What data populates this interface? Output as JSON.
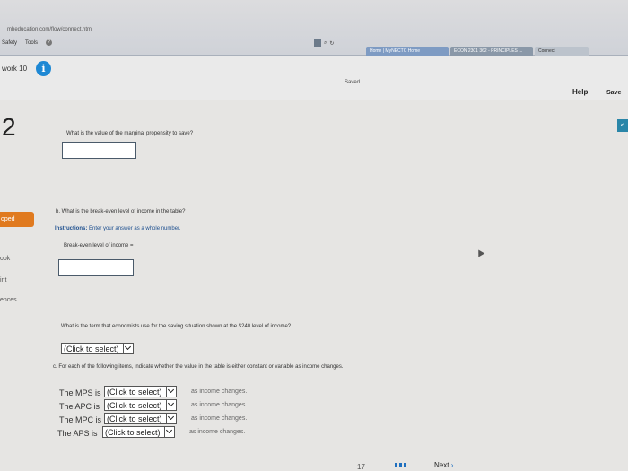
{
  "browser": {
    "url": "mheducation.com/flow/connect.html",
    "menu": [
      "Safety",
      "Tools"
    ],
    "tabs": [
      "Home | MyNECTC Home",
      "ECON 2301 362 - PRINCIPLES ...",
      "Connect"
    ]
  },
  "header": {
    "title": "work 10",
    "saved": "Saved",
    "help": "Help",
    "save": "Save"
  },
  "question": {
    "number": "2",
    "a_prompt": "What is the value of the marginal propensity to save?",
    "b_prompt": "b. What is the break-even level of income in the table?",
    "instructions_label": "Instructions:",
    "instructions_text": "Enter your answer as a whole number.",
    "breakeven_label": "Break-even level of income =",
    "term_prompt": "What is the term that economists use for the saving situation shown at the $240 level of income?",
    "term_select": "(Click to select)",
    "c_prompt": "c. For each of the following items, indicate whether the value in the table is either constant or variable as income changes.",
    "rows": [
      {
        "label": "The MPS is",
        "select": "(Click to select)",
        "suffix": "as income changes."
      },
      {
        "label": "The APC is",
        "select": "(Click to select)",
        "suffix": "as income changes."
      },
      {
        "label": "The MPC is",
        "select": "(Click to select)",
        "suffix": "as income changes."
      },
      {
        "label": "The APS is",
        "select": "(Click to select)",
        "suffix": "as income changes."
      }
    ]
  },
  "sidebar": {
    "pill": "oped",
    "links": [
      "ook",
      "int",
      "ences"
    ]
  },
  "footer": {
    "page": "17",
    "next": "Next"
  }
}
